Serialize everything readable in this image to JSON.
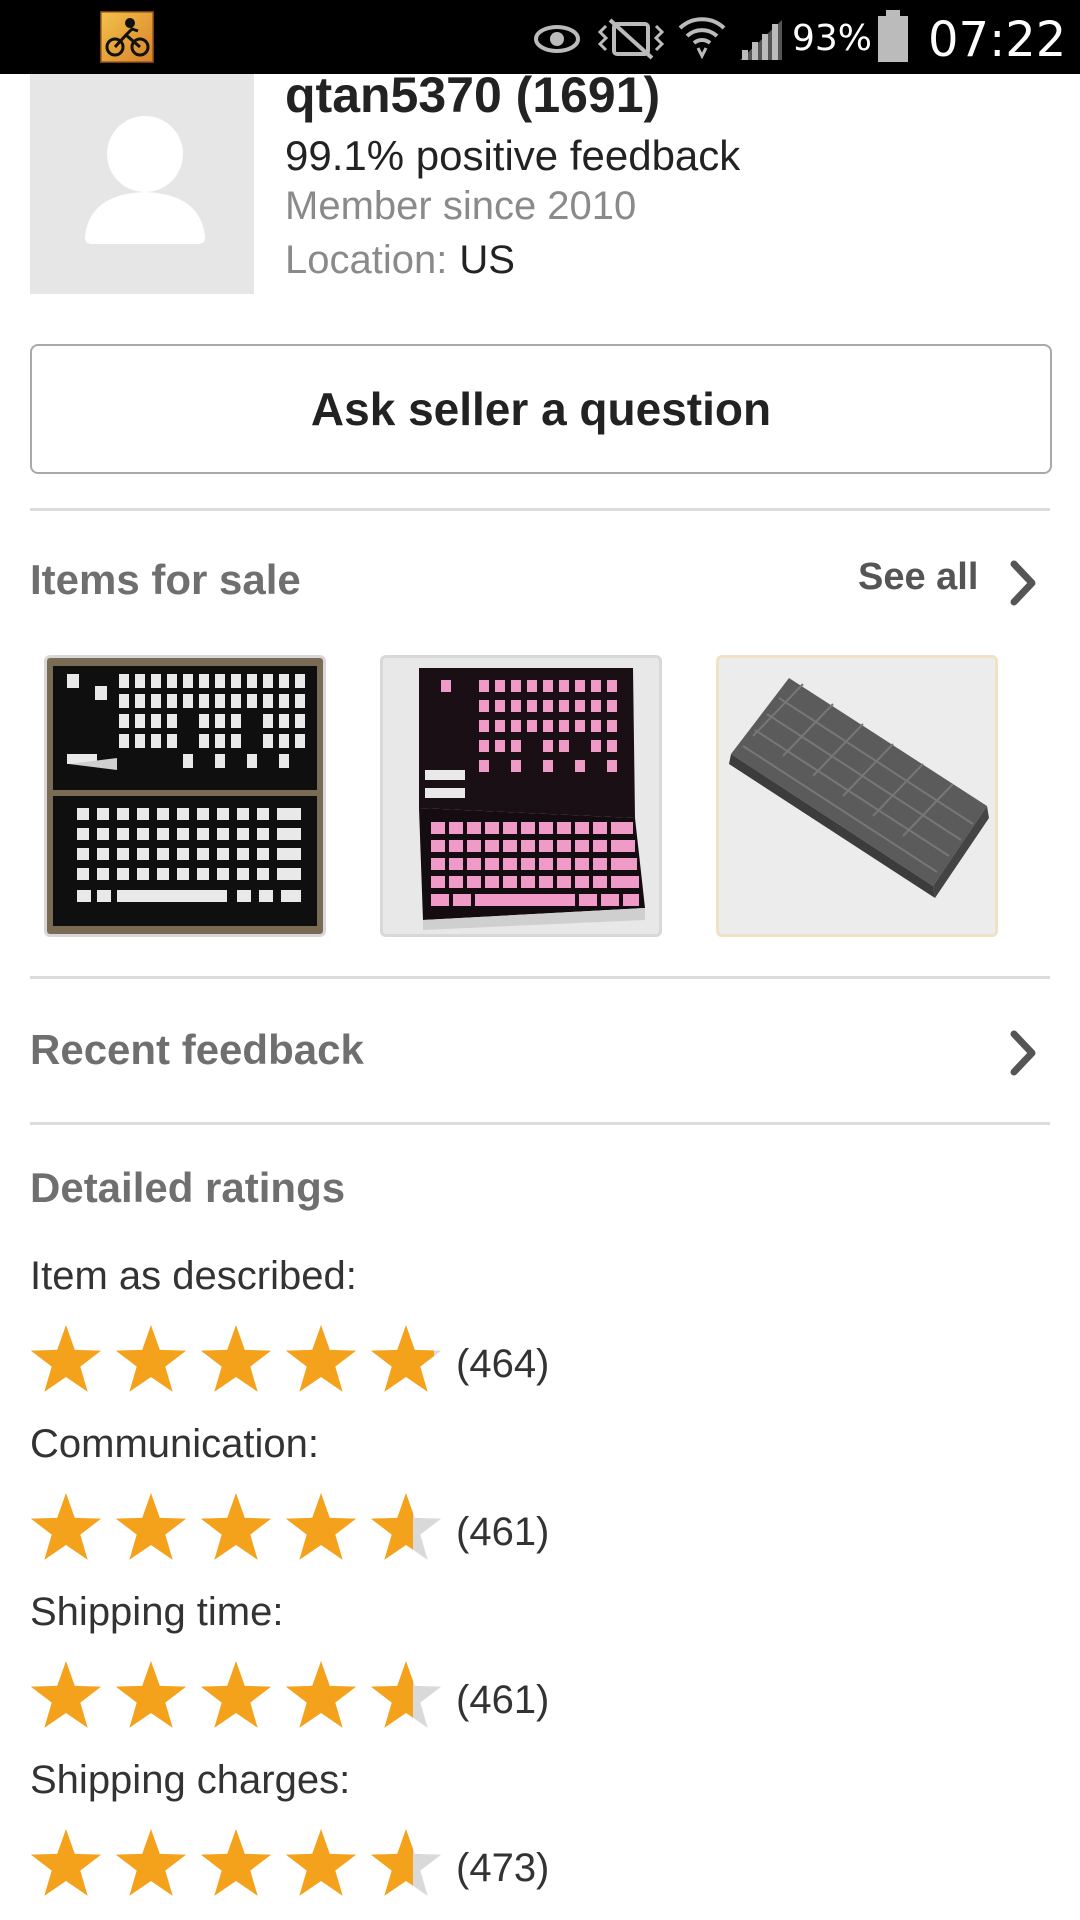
{
  "status_bar": {
    "battery_pct": "93%",
    "time": "07:22",
    "icons": [
      "app-notification-icon",
      "eye-icon",
      "vibrate-mute-icon",
      "wifi-icon",
      "signal-icon",
      "battery-icon"
    ]
  },
  "seller": {
    "name": "qtan5370 (1691)",
    "feedback": "99.1% positive feedback",
    "member_since": "Member since 2010",
    "location_label": "Location:",
    "location_value": "US"
  },
  "ask_button": {
    "label": "Ask seller a question"
  },
  "items_for_sale": {
    "title": "Items for sale",
    "see_all_label": "See all",
    "items": [
      {
        "icon": "keycap-set-black-white-thumbnail"
      },
      {
        "icon": "keycap-set-pink-thumbnail"
      },
      {
        "icon": "gray-keyboard-thumbnail"
      }
    ]
  },
  "recent_feedback": {
    "title": "Recent feedback"
  },
  "detailed_ratings": {
    "title": "Detailed ratings",
    "star_color": "#f4a21c",
    "star_empty_color": "#d9d9d9",
    "items": [
      {
        "label": "Item as described:",
        "stars": 4.9,
        "count": "(464)"
      },
      {
        "label": "Communication:",
        "stars": 4.6,
        "count": "(461)"
      },
      {
        "label": "Shipping time:",
        "stars": 4.6,
        "count": "(461)"
      },
      {
        "label": "Shipping charges:",
        "stars": 4.6,
        "count": "(473)"
      }
    ]
  }
}
